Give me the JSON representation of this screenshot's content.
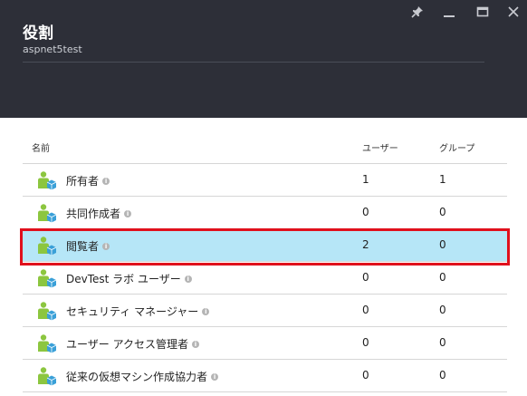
{
  "blade": {
    "title": "役割",
    "subtitle": "aspnet5test"
  },
  "window_controls": [
    "pin-icon",
    "minimize-icon",
    "maximize-icon",
    "close-icon"
  ],
  "table": {
    "headers": {
      "name": "名前",
      "users": "ユーザー",
      "groups": "グループ"
    },
    "rows": [
      {
        "name": "所有者",
        "users": "1",
        "groups": "1",
        "selected": false
      },
      {
        "name": "共同作成者",
        "users": "0",
        "groups": "0",
        "selected": false
      },
      {
        "name": "閲覧者",
        "users": "2",
        "groups": "0",
        "selected": true
      },
      {
        "name": "DevTest ラボ ユーザー",
        "users": "0",
        "groups": "0",
        "selected": false
      },
      {
        "name": "セキュリティ マネージャー",
        "users": "0",
        "groups": "0",
        "selected": false
      },
      {
        "name": "ユーザー アクセス管理者",
        "users": "0",
        "groups": "0",
        "selected": false
      },
      {
        "name": "従来の仮想マシン作成協力者",
        "users": "0",
        "groups": "0",
        "selected": false
      }
    ]
  },
  "colors": {
    "header_bg": "#2d2f38",
    "selected_row": "#b6e6f7",
    "highlight_border": "#e0101c",
    "icon_person": "#8cc63f",
    "icon_cube": "#3aa0d8"
  }
}
